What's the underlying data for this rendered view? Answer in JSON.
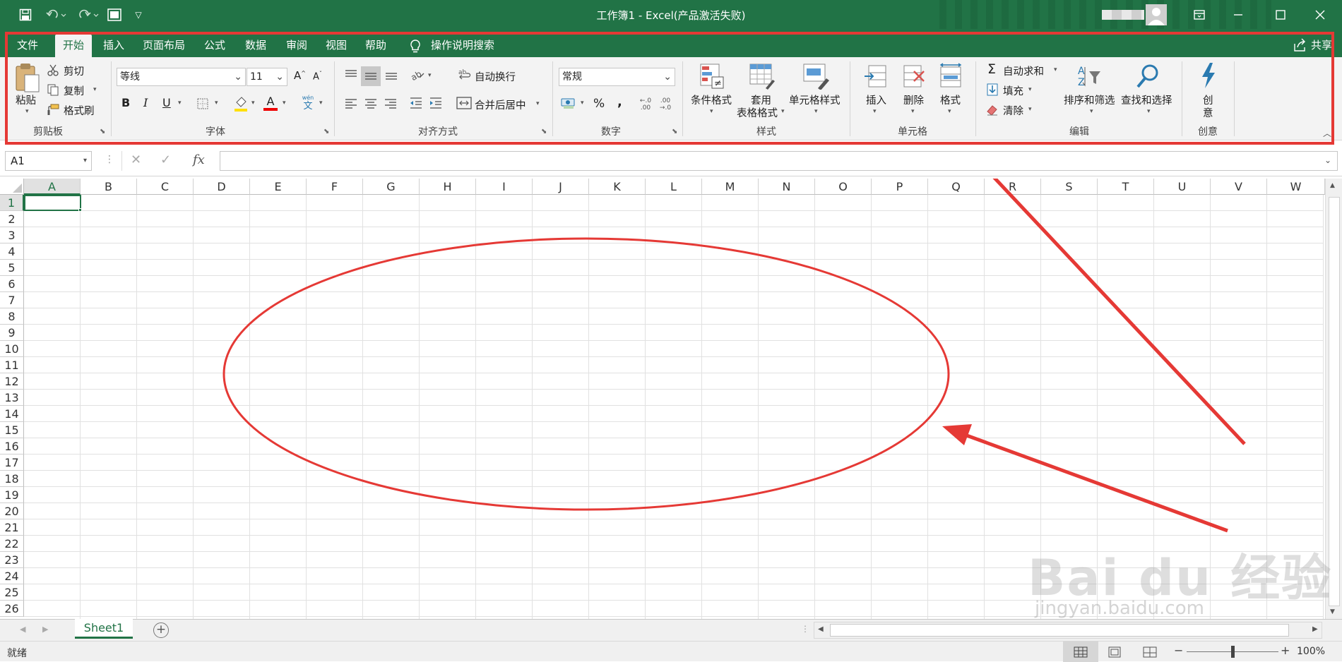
{
  "window": {
    "title": "工作簿1  -  Excel(产品激活失败)",
    "share_label": "共享"
  },
  "tabs": [
    {
      "label": "文件"
    },
    {
      "label": "开始",
      "active": true
    },
    {
      "label": "插入"
    },
    {
      "label": "页面布局"
    },
    {
      "label": "公式"
    },
    {
      "label": "数据"
    },
    {
      "label": "审阅"
    },
    {
      "label": "视图"
    },
    {
      "label": "帮助"
    }
  ],
  "tell_me": "操作说明搜索",
  "ribbon": {
    "clipboard": {
      "paste": "粘贴",
      "cut": "剪切",
      "copy": "复制",
      "format_painter": "格式刷",
      "group": "剪贴板"
    },
    "font": {
      "font_name": "等线",
      "font_size": "11",
      "bold": "B",
      "italic": "I",
      "underline": "U",
      "grow": "A",
      "shrink": "A",
      "font_color_glyph": "A",
      "phonetic_top": "wén",
      "phonetic_bottom": "文",
      "group": "字体"
    },
    "alignment": {
      "wrap_text": "自动换行",
      "merge_center": "合并后居中",
      "group": "对齐方式"
    },
    "number": {
      "format": "常规",
      "percent": "%",
      "comma": ",",
      "dec_increase": ".00",
      "dec_decrease": ".00",
      "group": "数字"
    },
    "styles": {
      "conditional": "条件格式",
      "table_line1": "套用",
      "table_line2": "表格格式",
      "cell_styles": "单元格样式",
      "group": "样式"
    },
    "cells": {
      "insert": "插入",
      "delete": "删除",
      "format": "格式",
      "group": "单元格"
    },
    "editing": {
      "autosum": "自动求和",
      "fill": "填充",
      "clear": "清除",
      "sort_filter": "排序和筛选",
      "find_select": "查找和选择",
      "group": "编辑"
    },
    "ideas": {
      "line1": "创",
      "line2": "意",
      "group": "创意"
    }
  },
  "formula_bar": {
    "name_box": "A1",
    "fx": "fx",
    "value": ""
  },
  "grid": {
    "columns": [
      "A",
      "B",
      "C",
      "D",
      "E",
      "F",
      "G",
      "H",
      "I",
      "J",
      "K",
      "L",
      "M",
      "N",
      "O",
      "P",
      "Q",
      "R",
      "S",
      "T",
      "U",
      "V",
      "W"
    ],
    "rows": [
      "1",
      "2",
      "3",
      "4",
      "5",
      "6",
      "7",
      "8",
      "9",
      "10",
      "11",
      "12",
      "13",
      "14",
      "15",
      "16",
      "17",
      "18",
      "19",
      "20",
      "21",
      "22",
      "23",
      "24",
      "25",
      "26"
    ],
    "selected_cell": "A1"
  },
  "sheets": [
    {
      "name": "Sheet1",
      "active": true
    }
  ],
  "status": {
    "ready": "就绪",
    "zoom_out": "−",
    "zoom_in": "+",
    "zoom": "100%",
    "zoom_fraction": 0.5
  },
  "watermark": {
    "brand": "Bai du 经验",
    "url": "jingyan.baidu.com"
  },
  "colors": {
    "accent": "#217346",
    "annotation": "#e53935"
  }
}
